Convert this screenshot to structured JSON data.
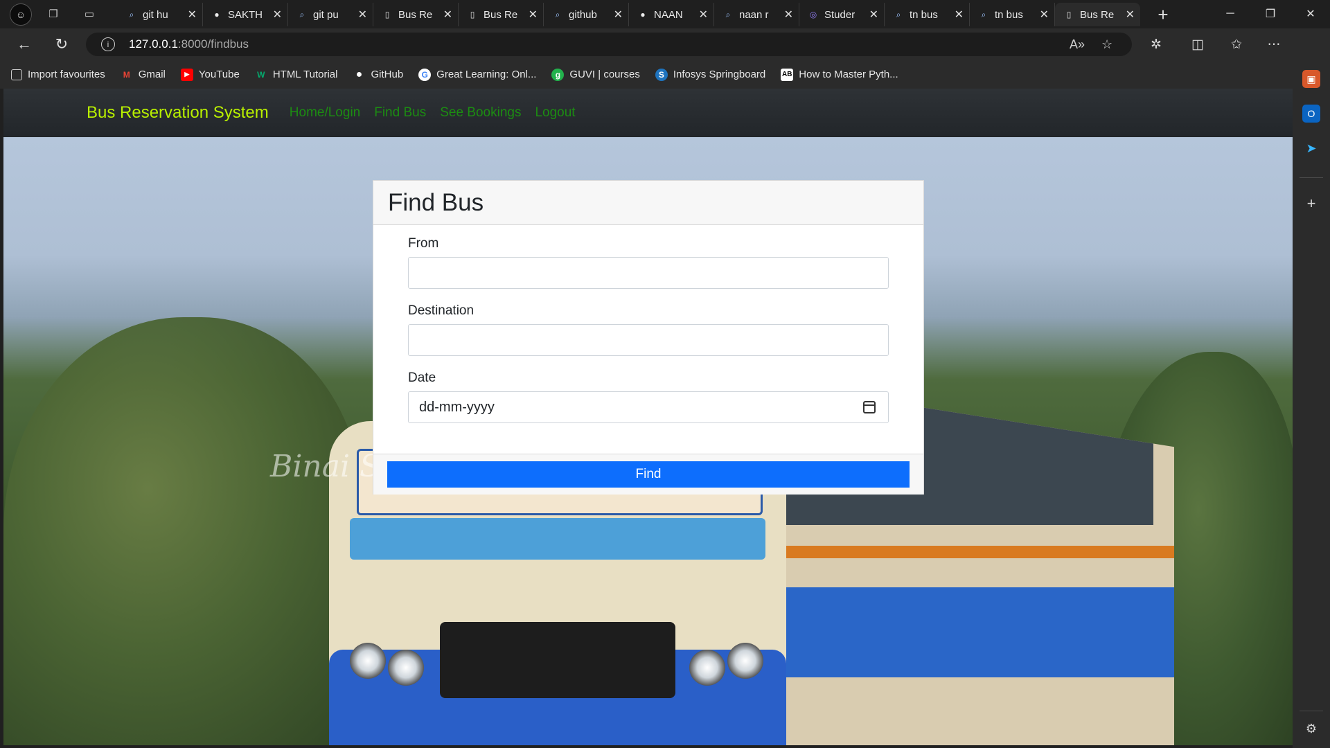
{
  "browser": {
    "tabs": [
      {
        "label": "git hu",
        "icon": "search-icon"
      },
      {
        "label": "SAKTH",
        "icon": "github-icon"
      },
      {
        "label": "git pu",
        "icon": "search-icon"
      },
      {
        "label": "Bus Re",
        "icon": "page-icon"
      },
      {
        "label": "Bus Re",
        "icon": "page-icon"
      },
      {
        "label": "github",
        "icon": "search-icon"
      },
      {
        "label": "NAAN",
        "icon": "github-icon"
      },
      {
        "label": "naan r",
        "icon": "search-icon"
      },
      {
        "label": "Studer",
        "icon": "app-icon"
      },
      {
        "label": "tn bus",
        "icon": "search-icon"
      },
      {
        "label": "tn bus",
        "icon": "search-icon"
      },
      {
        "label": "Bus Re",
        "icon": "page-icon",
        "active": true
      }
    ],
    "address": {
      "host": "127.0.0.1",
      "path": ":8000/findbus"
    },
    "favourites": [
      {
        "label": "Import favourites",
        "icon": "import-icon"
      },
      {
        "label": "Gmail",
        "icon": "gmail-icon",
        "mark": "M",
        "color": "#ea4335"
      },
      {
        "label": "YouTube",
        "icon": "youtube-icon",
        "mark": "▶",
        "color": "#ff0000"
      },
      {
        "label": "HTML Tutorial",
        "icon": "w3schools-icon",
        "mark": "W",
        "color": "#04aa6d"
      },
      {
        "label": "GitHub",
        "icon": "github-icon",
        "mark": "●",
        "color": "#ffffff"
      },
      {
        "label": "Great Learning: Onl...",
        "icon": "google-icon",
        "mark": "G",
        "color": "#ffffff"
      },
      {
        "label": "GUVI | courses",
        "icon": "guvi-icon",
        "mark": "g",
        "color": "#22b14c"
      },
      {
        "label": "Infosys Springboard",
        "icon": "infosys-icon",
        "mark": "S",
        "color": "#1e73be"
      },
      {
        "label": "How to Master Pyth...",
        "icon": "ab-icon",
        "mark": "AB",
        "color": "#ffffff"
      }
    ]
  },
  "site": {
    "brand": "Bus Reservation System",
    "nav": [
      "Home/Login",
      "Find Bus",
      "See Bookings",
      "Logout"
    ],
    "brand_color": "#b9f000",
    "link_color": "#1c8c12"
  },
  "form": {
    "title": "Find Bus",
    "fields": [
      {
        "label": "From",
        "value": ""
      },
      {
        "label": "Destination",
        "value": ""
      },
      {
        "label": "Date",
        "placeholder": "dd-mm-yyyy"
      }
    ],
    "submit_label": "Find",
    "submit_color": "#0d6efd"
  },
  "background": {
    "watermark": "Binai S"
  }
}
